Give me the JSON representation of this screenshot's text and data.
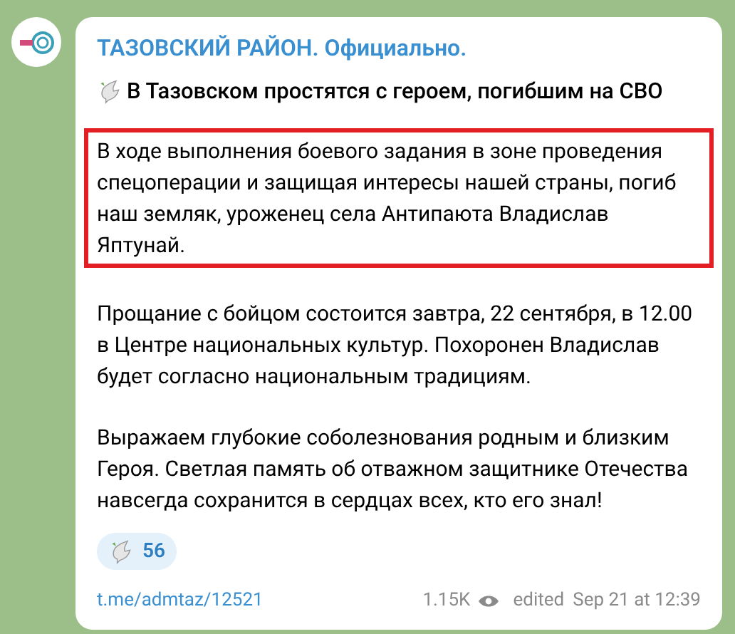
{
  "channel": {
    "name": "ТАЗОВСКИЙ РАЙОН. Официально."
  },
  "post": {
    "headline": "В Тазовском простятся с героем, погибшим на СВО",
    "paragraphs": [
      {
        "text": "В ходе выполнения боевого задания в зоне проведения спецоперации и защищая интересы нашей страны, погиб наш земляк, уроженец села Антипаюта Владислав Яптунай.",
        "highlighted": true
      },
      {
        "text": "Прощание с бойцом состоится завтра, 22 сентября, в 12.00 в Центре национальных культур. Похоронен Владислав будет согласно национальным традициям.",
        "highlighted": false
      },
      {
        "text": "Выражаем глубокие соболезнования родным и близким Героя. Светлая память об отважном защитнике Отечества навсегда сохранится в сердцах всех, кто его знал!",
        "highlighted": false
      }
    ]
  },
  "reaction": {
    "count": "56"
  },
  "footer": {
    "link": "t.me/admtaz/12521",
    "views": "1.15K",
    "edited": "edited",
    "time": "Sep 21 at 12:39"
  }
}
